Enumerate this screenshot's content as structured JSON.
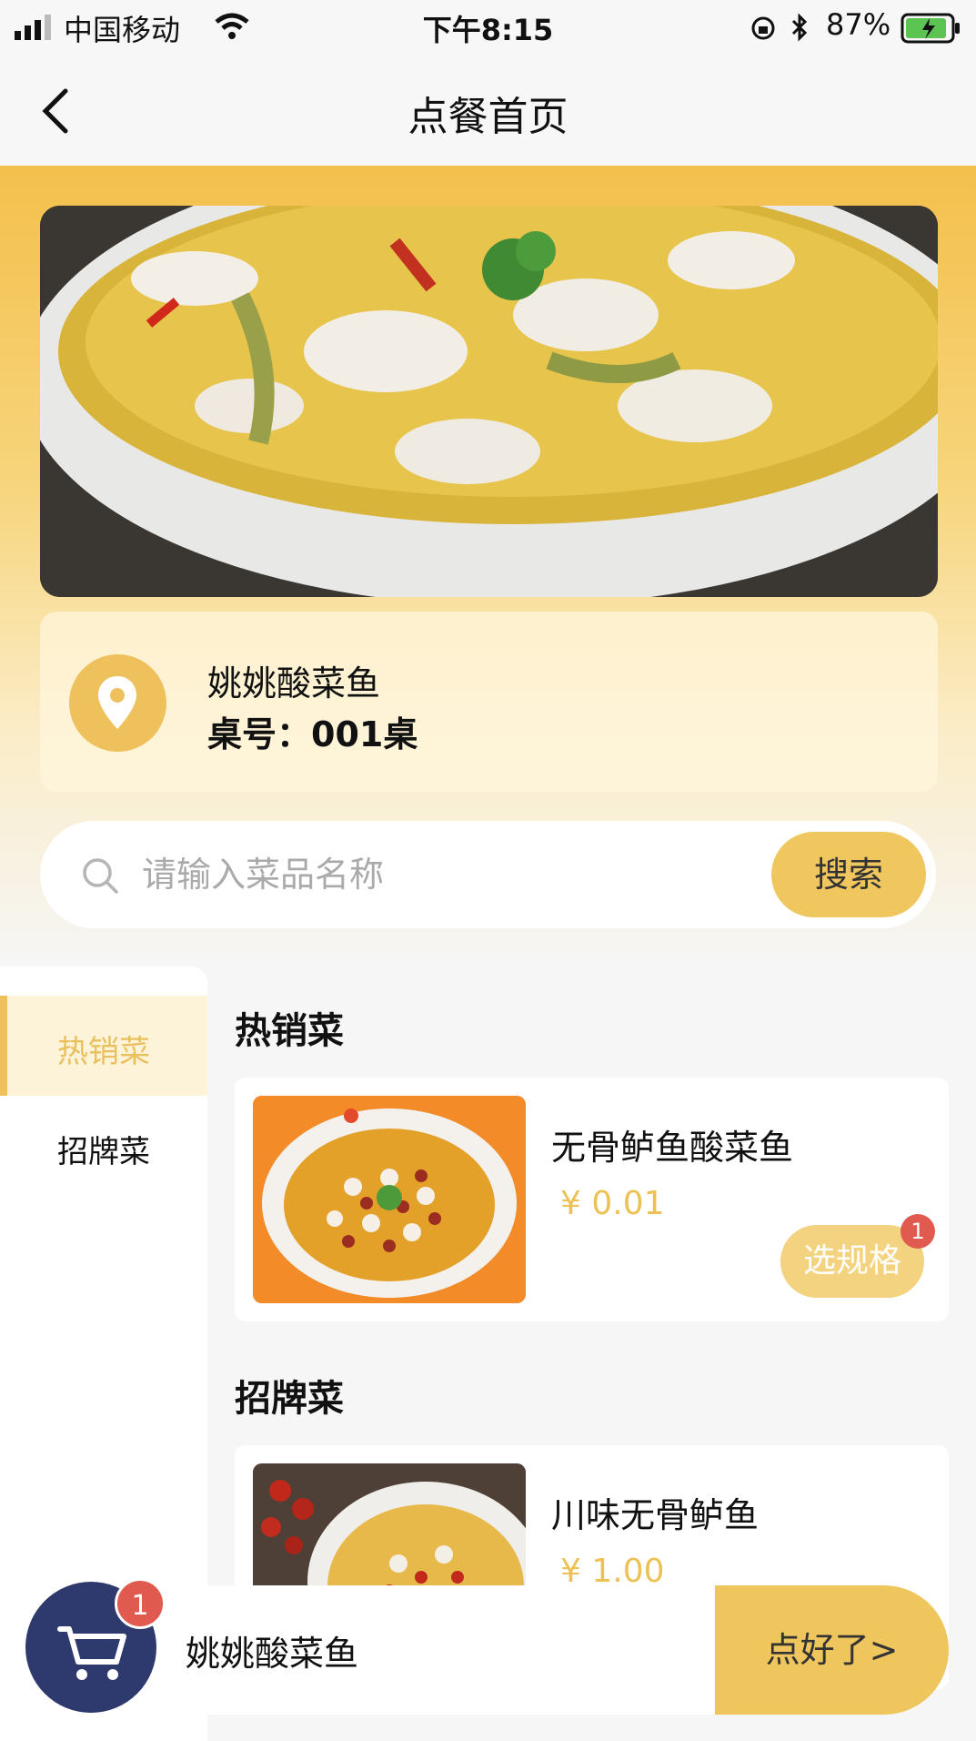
{
  "status_bar": {
    "carrier": "中国移动",
    "time": "下午8:15",
    "battery": "87%"
  },
  "nav": {
    "title": "点餐首页"
  },
  "store": {
    "name": "姚姚酸菜鱼",
    "table": "桌号：001桌"
  },
  "search": {
    "placeholder": "请输入菜品名称",
    "button": "搜索"
  },
  "categories": [
    {
      "label": "热销菜",
      "active": true
    },
    {
      "label": "招牌菜",
      "active": false
    }
  ],
  "sections": [
    {
      "title": "热销菜",
      "items": [
        {
          "name": "无骨鲈鱼酸菜鱼",
          "price": "¥ 0.01",
          "action": "选规格",
          "badge": "1"
        }
      ]
    },
    {
      "title": "招牌菜",
      "items": [
        {
          "name": "川味无骨鲈鱼",
          "price": "¥ 1.00"
        }
      ]
    }
  ],
  "cart": {
    "count": "1",
    "store_name": "姚姚酸菜鱼",
    "checkout": "点好了>"
  },
  "colors": {
    "accent": "#efc15c",
    "badge": "#e05a50",
    "cart": "#2e3a6e"
  }
}
